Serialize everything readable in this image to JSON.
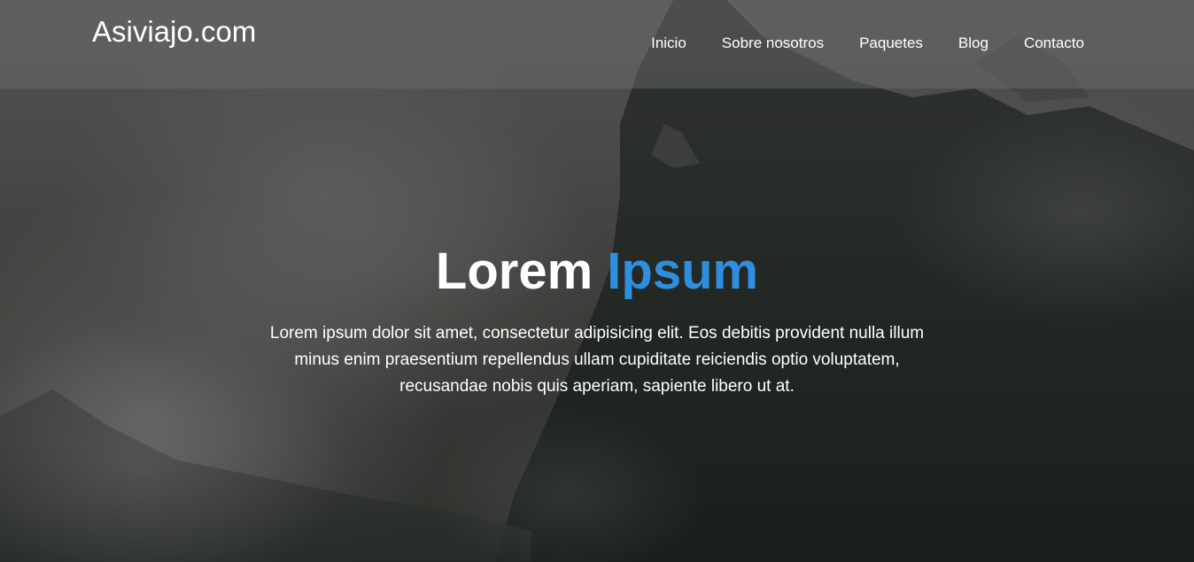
{
  "header": {
    "logo": "Asiviajo.com",
    "nav": [
      "Inicio",
      "Sobre nosotros",
      "Paquetes",
      "Blog",
      "Contacto"
    ]
  },
  "hero": {
    "title_main": "Lorem",
    "title_accent": "Ipsum",
    "text": "Lorem ipsum dolor sit amet, consectetur adipisicing elit. Eos debitis provident nulla illum minus enim praesentium repellendus ullam cupiditate reiciendis optio voluptatem, recusandae nobis quis aperiam, sapiente libero ut at."
  },
  "colors": {
    "accent": "#2e8fe0",
    "header_overlay": "rgba(110,110,110,0.45)"
  }
}
